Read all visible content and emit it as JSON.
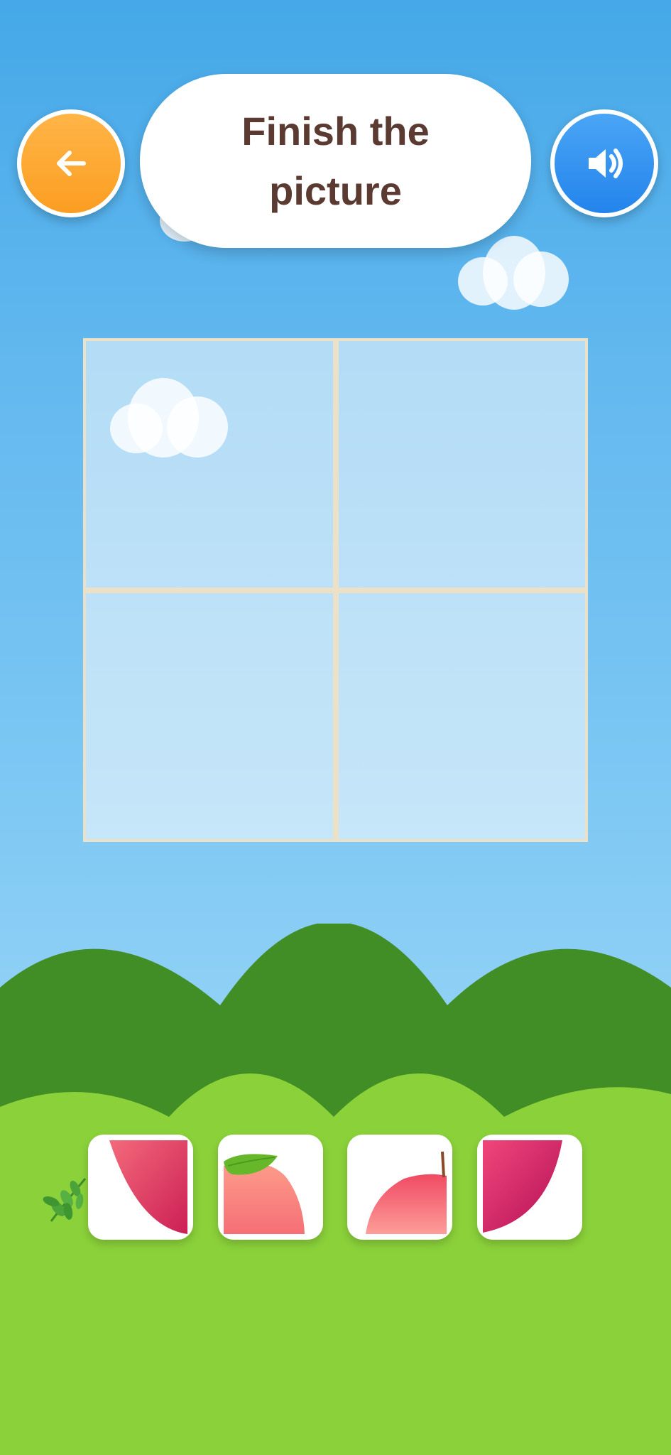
{
  "header": {
    "title": "Finish the picture",
    "back_icon": "arrow-left-icon",
    "sound_icon": "speaker-icon"
  },
  "colors": {
    "sky_top": "#45a8e8",
    "sky_bottom": "#a6dcf7",
    "back_button": "#fb9e22",
    "sound_button": "#2384ec",
    "title_text": "#5b3a32",
    "board_border": "#ece1c6",
    "hill_dark": "#418d26",
    "hill_light": "#8bd23a"
  },
  "board": {
    "rows": 2,
    "cols": 2,
    "slots": [
      "empty",
      "empty",
      "empty",
      "empty"
    ]
  },
  "pieces": [
    {
      "id": "piece-bottom-left",
      "icon": "apple-bottom-left-piece"
    },
    {
      "id": "piece-top-left",
      "icon": "apple-top-left-leaf-piece"
    },
    {
      "id": "piece-top-right",
      "icon": "apple-top-right-stem-piece"
    },
    {
      "id": "piece-bottom-right",
      "icon": "apple-bottom-right-piece"
    }
  ],
  "decorations": {
    "herb_icon": "herb-icon"
  }
}
